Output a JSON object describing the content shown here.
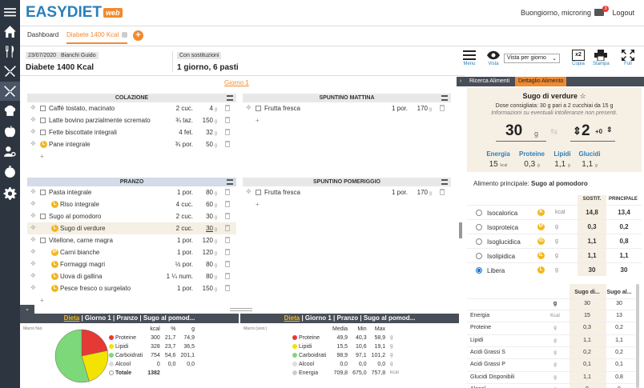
{
  "app": {
    "logo_text": "EASYDIET",
    "logo_badge": "web",
    "greeting": "Buongiorno, microring",
    "mail_badge": "3",
    "logout": "Logout"
  },
  "tabs": {
    "dashboard": "Dashboard",
    "diet": "Diabete 1400 Kcal",
    "add": "+"
  },
  "info": {
    "date": "23/07/2020",
    "patient": "Bianchi Guido",
    "diet_name": "Diabete 1400 Kcal",
    "subs_label": "Con sostituzioni",
    "meals_summary": "1 giorno, 6 pasti"
  },
  "toolbar": {
    "menu": "Menu",
    "vista": "Vista",
    "view_select": "Vista per giorno",
    "copia": "Copia",
    "copia_badge": "x2",
    "stampa": "Stampa",
    "full": "Full"
  },
  "day_label": "Giorno 1",
  "meals": {
    "colazione": {
      "title": "COLAZIONE",
      "items": [
        {
          "name": "Caffè tostato, macinato",
          "qty": "2 cuc.",
          "g": "4",
          "unit": "g",
          "badge": false
        },
        {
          "name": "Latte bovino parzialmente scremato",
          "qty": "¾ taz.",
          "g": "150",
          "unit": "g",
          "badge": false
        },
        {
          "name": "Fette biscottate integrali",
          "qty": "4 fet.",
          "g": "32",
          "unit": "g",
          "badge": false
        },
        {
          "name": "Pane integrale",
          "qty": "¾ por.",
          "g": "50",
          "unit": "g",
          "badge": true,
          "badge_text": "L"
        }
      ]
    },
    "spuntino_mattina": {
      "title": "SPUNTINO MATTINA",
      "items": [
        {
          "name": "Frutta fresca",
          "qty": "1 por.",
          "g": "170",
          "unit": "g",
          "badge": false
        }
      ]
    },
    "pranzo": {
      "title": "PRANZO",
      "items": [
        {
          "name": "Pasta integrale",
          "qty": "1 por.",
          "g": "80",
          "unit": "g",
          "badge": false,
          "level": 0
        },
        {
          "name": "Riso integrale",
          "qty": "4 cuc.",
          "g": "60",
          "unit": "g",
          "badge": true,
          "badge_text": "L",
          "level": 1
        },
        {
          "name": "Sugo al pomodoro",
          "qty": "2 cuc.",
          "g": "30",
          "unit": "g",
          "badge": false,
          "level": 0
        },
        {
          "name": "Sugo di verdure",
          "qty": "2 cuc.",
          "g": "30",
          "unit": "g",
          "badge": true,
          "badge_text": "L",
          "level": 1,
          "selected": true
        },
        {
          "name": "Vitellone, carne magra",
          "qty": "1 por.",
          "g": "120",
          "unit": "g",
          "badge": false,
          "level": 0
        },
        {
          "name": "Carni bianche",
          "qty": "1 por.",
          "g": "120",
          "unit": "g",
          "badge": true,
          "badge_text": "IP",
          "level": 1
        },
        {
          "name": "Formaggi magri",
          "qty": "½ por.",
          "g": "80",
          "unit": "g",
          "badge": true,
          "badge_text": "L",
          "level": 1
        },
        {
          "name": "Uova di gallina",
          "qty": "1 ¼ num.",
          "g": "80",
          "unit": "g",
          "badge": true,
          "badge_text": "L",
          "level": 1
        },
        {
          "name": "Pesce fresco o surgelato",
          "qty": "1 por.",
          "g": "150",
          "unit": "g",
          "badge": true,
          "badge_text": "L",
          "level": 1
        }
      ]
    },
    "spuntino_pomeriggio": {
      "title": "SPUNTINO POMERIGGIO",
      "items": [
        {
          "name": "Frutta fresca",
          "qty": "1 por.",
          "g": "170",
          "unit": "g",
          "badge": false
        }
      ]
    }
  },
  "bottom_left": {
    "crumbs": [
      "Dieta",
      "Giorno 1",
      "Pranzo",
      "Sugo al pomod..."
    ],
    "title": "Macro Nut.",
    "headers": [
      "kcal",
      "%",
      "g"
    ],
    "rows": [
      {
        "name": "Proteine",
        "color": "#e53935",
        "kcal": "300",
        "pct": "21,7",
        "g": "74,9"
      },
      {
        "name": "Lipidi",
        "color": "#f2e300",
        "kcal": "328",
        "pct": "23,7",
        "g": "36,5"
      },
      {
        "name": "Carboidrati",
        "color": "#7dd87a",
        "kcal": "754",
        "pct": "54,6",
        "g": "201,1"
      },
      {
        "name": "Alcool",
        "color": "#dddddd",
        "kcal": "0",
        "pct": "0,0",
        "g": "0,0"
      }
    ],
    "total_label": "Totale",
    "total_kcal": "1382"
  },
  "bottom_mid": {
    "crumbs": [
      "Dieta",
      "Giorno 1",
      "Pranzo",
      "Sugo al pomod..."
    ],
    "title": "Macro (sost.)",
    "headers": [
      "Media",
      "Min",
      "Max"
    ],
    "rows": [
      {
        "name": "Proteine",
        "color": "#e53935",
        "media": "49,9",
        "min": "40,3",
        "max": "58,9",
        "unit": "g"
      },
      {
        "name": "Lipidi",
        "color": "#f2e300",
        "media": "15,5",
        "min": "10,6",
        "max": "19,1",
        "unit": "g"
      },
      {
        "name": "Carboidrati",
        "color": "#7dd87a",
        "media": "98,9",
        "min": "97,1",
        "max": "101,2",
        "unit": "g"
      },
      {
        "name": "Alcool",
        "color": "#dddddd",
        "media": "0,0",
        "min": "0,0",
        "max": "0,0",
        "unit": "g"
      },
      {
        "name": "Energia",
        "color": "#cccccc",
        "media": "709,8",
        "min": "675,0",
        "max": "757,8",
        "unit": "kcal"
      }
    ]
  },
  "right": {
    "tab_search": "Ricerca Alimenti",
    "tab_detail": "Dettaglio Alimento",
    "food_title": "Sugo di verdure",
    "dose_text": "Dose consigliata: 30 g pari a 2 cucchiai da 15 g",
    "intol_text": "Informazioni su eventuali intolleranze non presenti.",
    "grams": "30",
    "grams_unit": "g",
    "portions": "2",
    "plus_zero": "+0",
    "macros": [
      {
        "label": "Energia",
        "value": "15",
        "unit": "kcal"
      },
      {
        "label": "Proteine",
        "value": "0,3",
        "unit": "g"
      },
      {
        "label": "Lipidi",
        "value": "1,1",
        "unit": "g"
      },
      {
        "label": "Glucidi",
        "value": "1,1",
        "unit": "g"
      }
    ],
    "main_food_label": "Alimento principale:",
    "main_food": "Sugo al pomodoro",
    "col_sostit": "SOSTIT.",
    "col_principale": "PRINCIPALE",
    "subs": [
      {
        "name": "Isocalorica",
        "badge": "K",
        "unit": "kcal",
        "sostit": "14,8",
        "princ": "13,4",
        "selected": false
      },
      {
        "name": "Isoproteica",
        "badge": "IP",
        "unit": "g",
        "sostit": "0,3",
        "princ": "0,2",
        "selected": false
      },
      {
        "name": "Isoglucidica",
        "badge": "IG",
        "unit": "g",
        "sostit": "1,1",
        "princ": "0,8",
        "selected": false
      },
      {
        "name": "Isolipidica",
        "badge": "IL",
        "unit": "g",
        "sostit": "1,1",
        "princ": "1,1",
        "selected": false
      },
      {
        "name": "Libera",
        "badge": "L",
        "unit": "g",
        "sostit": "30",
        "princ": "30",
        "selected": true
      }
    ],
    "nut_headers": [
      "Sugo di...",
      "Sugo al..."
    ],
    "nut_unit_header": "g",
    "nut_qty": [
      "30",
      "30"
    ],
    "nutrients": [
      {
        "name": "Energia",
        "unit": "Kcal",
        "a": "15",
        "b": "13"
      },
      {
        "name": "Proteine",
        "unit": "g",
        "a": "0,3",
        "b": "0,2"
      },
      {
        "name": "Lipidi",
        "unit": "g",
        "a": "1,1",
        "b": "1,1"
      },
      {
        "name": "Acidi Grassi S",
        "unit": "g",
        "a": "0,2",
        "b": "0,2"
      },
      {
        "name": "Acidi Grassi P",
        "unit": "g",
        "a": "0,1",
        "b": "0,1"
      },
      {
        "name": "Glucidi Disponibili",
        "unit": "g",
        "a": "1,1",
        "b": "0,8"
      },
      {
        "name": "Alcool",
        "unit": "g",
        "a": "0",
        "b": "0"
      }
    ]
  },
  "colors": {
    "accent": "#f28a2e",
    "brand": "#2a7fba",
    "sidebar": "#2d3541",
    "dark_header": "#474e58"
  }
}
